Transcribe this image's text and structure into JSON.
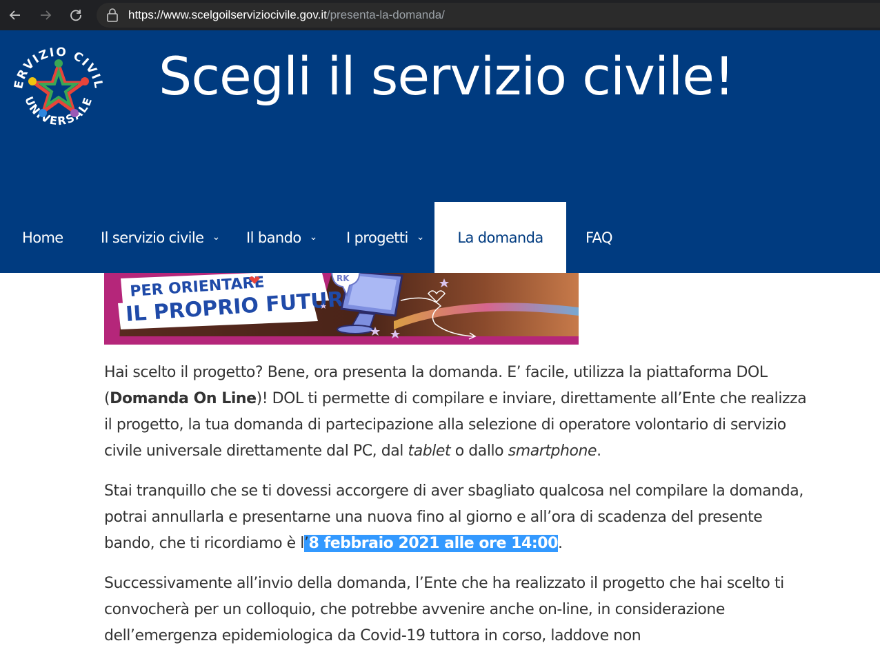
{
  "browser": {
    "back_icon": "arrow-left-icon",
    "forward_icon": "arrow-right-icon",
    "reload_icon": "reload-icon",
    "url_host": "https://www.scelgoilserviziocivile.gov.it",
    "url_path": "/presenta-la-domanda/"
  },
  "header": {
    "logo": "servizio-civile-universale-logo",
    "logo_text_top": "SERVIZIO CIVILE",
    "logo_text_bottom": "UNIVERSALE",
    "title": "Scegli il servizio civile!",
    "background_color": "#003b80"
  },
  "nav": {
    "items": [
      {
        "label": "Home",
        "has_dropdown": false,
        "active": false
      },
      {
        "label": "Il servizio civile",
        "has_dropdown": true,
        "active": false
      },
      {
        "label": "Il bando",
        "has_dropdown": true,
        "active": false
      },
      {
        "label": "I progetti",
        "has_dropdown": true,
        "active": false
      },
      {
        "label": "La domanda",
        "has_dropdown": false,
        "active": true
      },
      {
        "label": "FAQ",
        "has_dropdown": false,
        "active": false
      }
    ]
  },
  "banner": {
    "line1": "PER ORIENTARE",
    "line2": "IL PROPRIO FUTURO",
    "badge": "RK"
  },
  "content": {
    "p1_a": "Hai scelto il progetto? Bene, ora presenta la domanda. E’ facile, utilizza la piattaforma DOL (",
    "p1_bold": "Domanda On Line",
    "p1_b": ")! DOL ti permette di compilare e inviare, direttamente  all’Ente che realizza il progetto, la tua domanda di partecipazione alla selezione di operatore volontario di servizio civile universale direttamente dal PC, dal ",
    "p1_i1": "tablet",
    "p1_c": " o dallo ",
    "p1_i2": "smartphone",
    "p1_d": ".",
    "p2_a": "Stai tranquillo che se ti dovessi accorgere di aver sbagliato qualcosa nel compilare la domanda, potrai annullarla e presentarne una nuova fino al giorno e all’ora di scadenza del presente bando, che ti ricordiamo è l",
    "p2_hl_apos": "’",
    "p2_hl": "8 febbraio 2021 alle ore 14:00",
    "p2_end": ".",
    "p3": "Successivamente all’invio della domanda, l’Ente che ha realizzato il progetto che hai scelto ti convocherà per un colloquio, che potrebbe avvenire anche on-line, in considerazione dell’emergenza epidemiologica da Covid-19 tuttora in corso, laddove non"
  }
}
